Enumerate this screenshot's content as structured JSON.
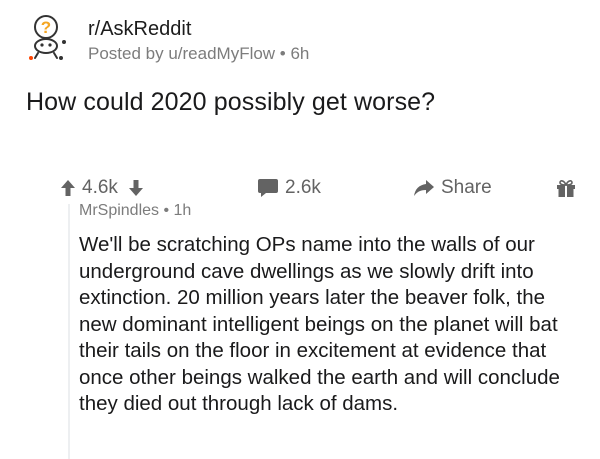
{
  "post": {
    "subreddit": "r/AskReddit",
    "posted_by": "Posted by u/readMyFlow • 6h",
    "title": "How could 2020 possibly get worse?",
    "subreddit_icon": "askreddit-snoo-icon"
  },
  "actions": {
    "upvotes": "4.6k",
    "comments": "2.6k",
    "share": "Share",
    "upvote_icon": "upvote-arrow-icon",
    "downvote_icon": "downvote-arrow-icon",
    "comment_icon": "comment-bubble-icon",
    "share_icon": "share-arrow-icon",
    "award_icon": "gift-award-icon"
  },
  "comment": {
    "meta": "MrSpindles • 1h",
    "body": "We'll be scratching OPs name into the walls of our underground cave dwellings as we slowly drift into extinction.  20 million years later the beaver folk, the new dominant intelligent beings on the planet will bat their tails on the floor in excitement at evidence that once other beings walked the earth and will conclude they died out through lack of dams."
  },
  "colors": {
    "text": "#1a1a1b",
    "muted": "#7c7c7c",
    "icon_gray": "#636363",
    "askreddit_question": "#f5a623",
    "thread_line": "#edeff1"
  }
}
